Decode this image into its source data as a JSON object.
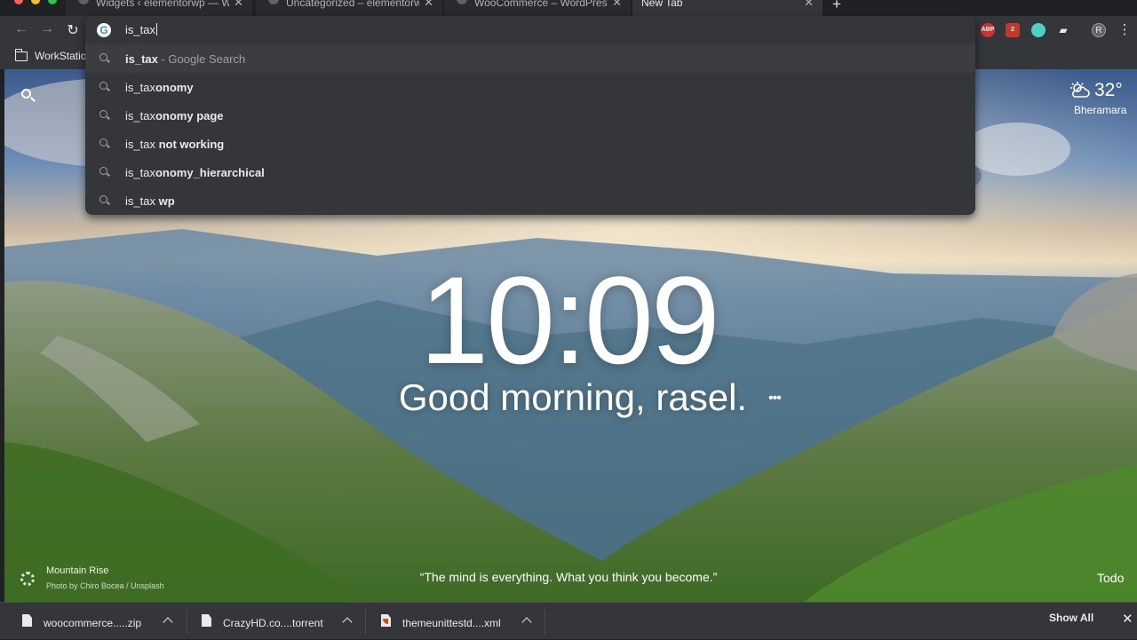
{
  "window": {
    "traffic_lights": [
      "#ff5f57",
      "#febc2e",
      "#28c840"
    ]
  },
  "tabs": [
    {
      "title": "Widgets ‹ elementorwp — Wo",
      "icon": "wordpress-icon",
      "active": false
    },
    {
      "title": "Uncategorized – elementorwp",
      "icon": "wordpress-icon",
      "active": false
    },
    {
      "title": "WooCommerce – WordPress p",
      "icon": "wordpress-icon",
      "active": false
    },
    {
      "title": "New Tab",
      "icon": "",
      "active": true
    }
  ],
  "toolbar": {
    "back": "←",
    "forward": "→",
    "reload": "↻",
    "extensions": [
      {
        "label": "ABP",
        "color": "#d32f2f"
      },
      {
        "label": "2",
        "color": "#c0392b"
      },
      {
        "label": "",
        "color": "#4dd0c8"
      },
      {
        "label": "",
        "color": "#e8eaed"
      }
    ],
    "profile_initial": "R",
    "menu": "⋮"
  },
  "bookmarks": {
    "folder_label": "WorkStation"
  },
  "omnibox": {
    "value": "is_tax",
    "suggestions": [
      {
        "typed": "is_tax",
        "rest": "",
        "desc": " - Google Search",
        "selected": true
      },
      {
        "typed": "is_tax",
        "rest": "onomy",
        "desc": "",
        "selected": false
      },
      {
        "typed": "is_tax",
        "rest": "onomy page",
        "desc": "",
        "selected": false
      },
      {
        "typed": "is_tax",
        "rest": " not working",
        "desc": "",
        "selected": false
      },
      {
        "typed": "is_tax",
        "rest": "onomy_hierarchical",
        "desc": "",
        "selected": false
      },
      {
        "typed": "is_tax",
        "rest": " wp",
        "desc": "",
        "selected": false
      }
    ]
  },
  "momentum": {
    "weather_temp": "32°",
    "weather_location": "Bheramara",
    "clock": "10:09",
    "greeting": "Good morning, rasel.",
    "more": "•••",
    "photo_name": "Mountain Rise",
    "photo_credit": "Photo by Chiro Bocea / Unsplash",
    "quote": "“The mind is everything. What you think you become.”",
    "todo": "Todo"
  },
  "downloads": {
    "items": [
      {
        "name": "woocommerce.....zip",
        "type": "file"
      },
      {
        "name": "CrazyHD.co....torrent",
        "type": "file"
      },
      {
        "name": "themeunittestd....xml",
        "type": "xml"
      }
    ],
    "show_all": "Show All",
    "close": "✕"
  }
}
